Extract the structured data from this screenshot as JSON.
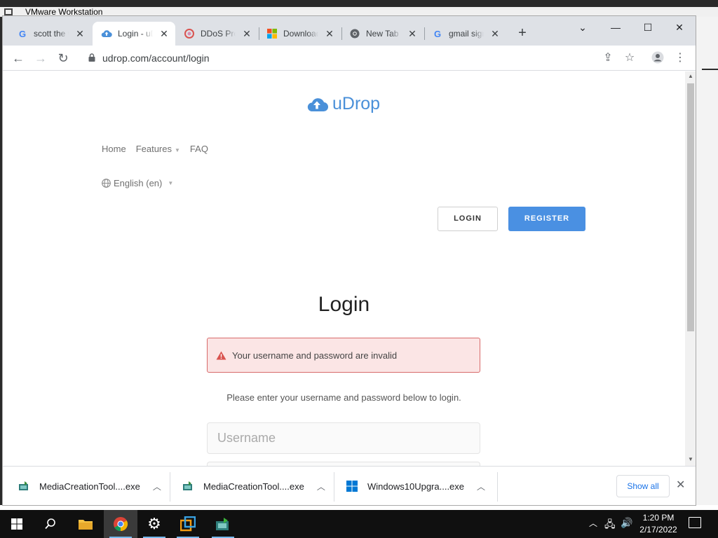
{
  "vm_window": {
    "title": "VMware Workstation",
    "status_text": "mware"
  },
  "tabs": [
    {
      "title": "scott the w",
      "favicon": "google-icon"
    },
    {
      "title": "Login - uDr",
      "favicon": "udrop-cloud-icon",
      "active": true
    },
    {
      "title": "DDoS Prot",
      "favicon": "ddos-icon"
    },
    {
      "title": "Download",
      "favicon": "microsoft-icon"
    },
    {
      "title": "New Tab",
      "favicon": "chrome-icon"
    },
    {
      "title": "gmail sign",
      "favicon": "google-icon"
    }
  ],
  "address_bar": {
    "url": "udrop.com/account/login"
  },
  "site": {
    "logo_text": "uDrop",
    "nav": {
      "home": "Home",
      "features": "Features",
      "faq": "FAQ"
    },
    "language": "English (en)",
    "login_button": "LOGIN",
    "register_button": "REGISTER",
    "page_title": "Login",
    "error_message": "Your username and password are invalid",
    "instruction": "Please enter your username and password below to login.",
    "username_placeholder": "Username"
  },
  "downloads": {
    "items": [
      {
        "name": "MediaCreationTool....exe",
        "icon": "media-creation-tool-icon"
      },
      {
        "name": "MediaCreationTool....exe",
        "icon": "media-creation-tool-icon"
      },
      {
        "name": "Windows10Upgra....exe",
        "icon": "windows-icon"
      }
    ],
    "show_all": "Show all"
  },
  "taskbar": {
    "time": "1:20 PM",
    "date": "2/17/2022"
  },
  "colors": {
    "accent": "#4a90e2",
    "error_bg": "#fbe5e5",
    "error_border": "#d86a6a",
    "tab_strip": "#dee1e6"
  }
}
